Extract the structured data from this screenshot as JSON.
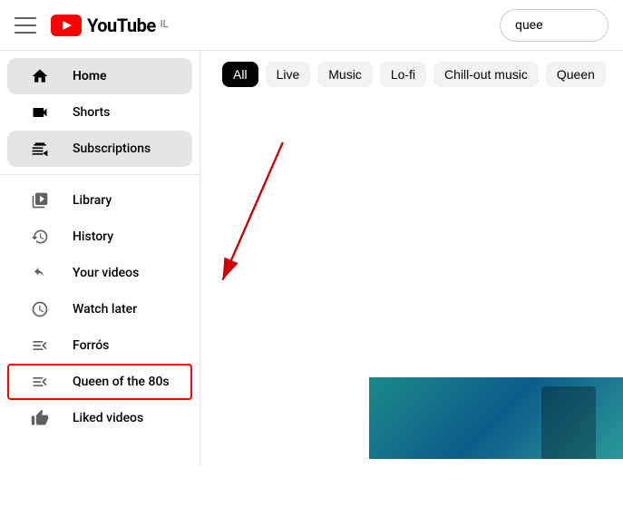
{
  "header": {
    "menu_label": "Menu",
    "logo_text": "YouTube",
    "country_code": "IL",
    "search_value": "quee"
  },
  "sidebar": {
    "items": [
      {
        "id": "home",
        "label": "Home",
        "icon": "home",
        "active": true,
        "highlighted": false
      },
      {
        "id": "shorts",
        "label": "Shorts",
        "icon": "shorts",
        "active": false,
        "highlighted": false
      },
      {
        "id": "subscriptions",
        "label": "Subscriptions",
        "icon": "subscriptions",
        "active": false,
        "highlighted": false
      },
      {
        "id": "library",
        "label": "Library",
        "icon": "library",
        "active": false,
        "highlighted": false
      },
      {
        "id": "history",
        "label": "History",
        "icon": "history",
        "active": false,
        "highlighted": false
      },
      {
        "id": "your-videos",
        "label": "Your videos",
        "icon": "your-videos",
        "active": false,
        "highlighted": false
      },
      {
        "id": "watch-later",
        "label": "Watch later",
        "icon": "watch-later",
        "active": false,
        "highlighted": false
      },
      {
        "id": "forrós",
        "label": "Forrós",
        "icon": "playlist",
        "active": false,
        "highlighted": false
      },
      {
        "id": "queen-80s",
        "label": "Queen of the 80s",
        "icon": "playlist",
        "active": false,
        "highlighted": true
      },
      {
        "id": "liked-videos",
        "label": "Liked videos",
        "icon": "liked",
        "active": false,
        "highlighted": false
      }
    ]
  },
  "filter_chips": {
    "items": [
      {
        "id": "all",
        "label": "All",
        "active": true
      },
      {
        "id": "live",
        "label": "Live",
        "active": false
      },
      {
        "id": "music",
        "label": "Music",
        "active": false
      },
      {
        "id": "lofi",
        "label": "Lo-fi",
        "active": false
      },
      {
        "id": "chill",
        "label": "Chill-out music",
        "active": false
      },
      {
        "id": "queen",
        "label": "Queen",
        "active": false
      }
    ]
  }
}
